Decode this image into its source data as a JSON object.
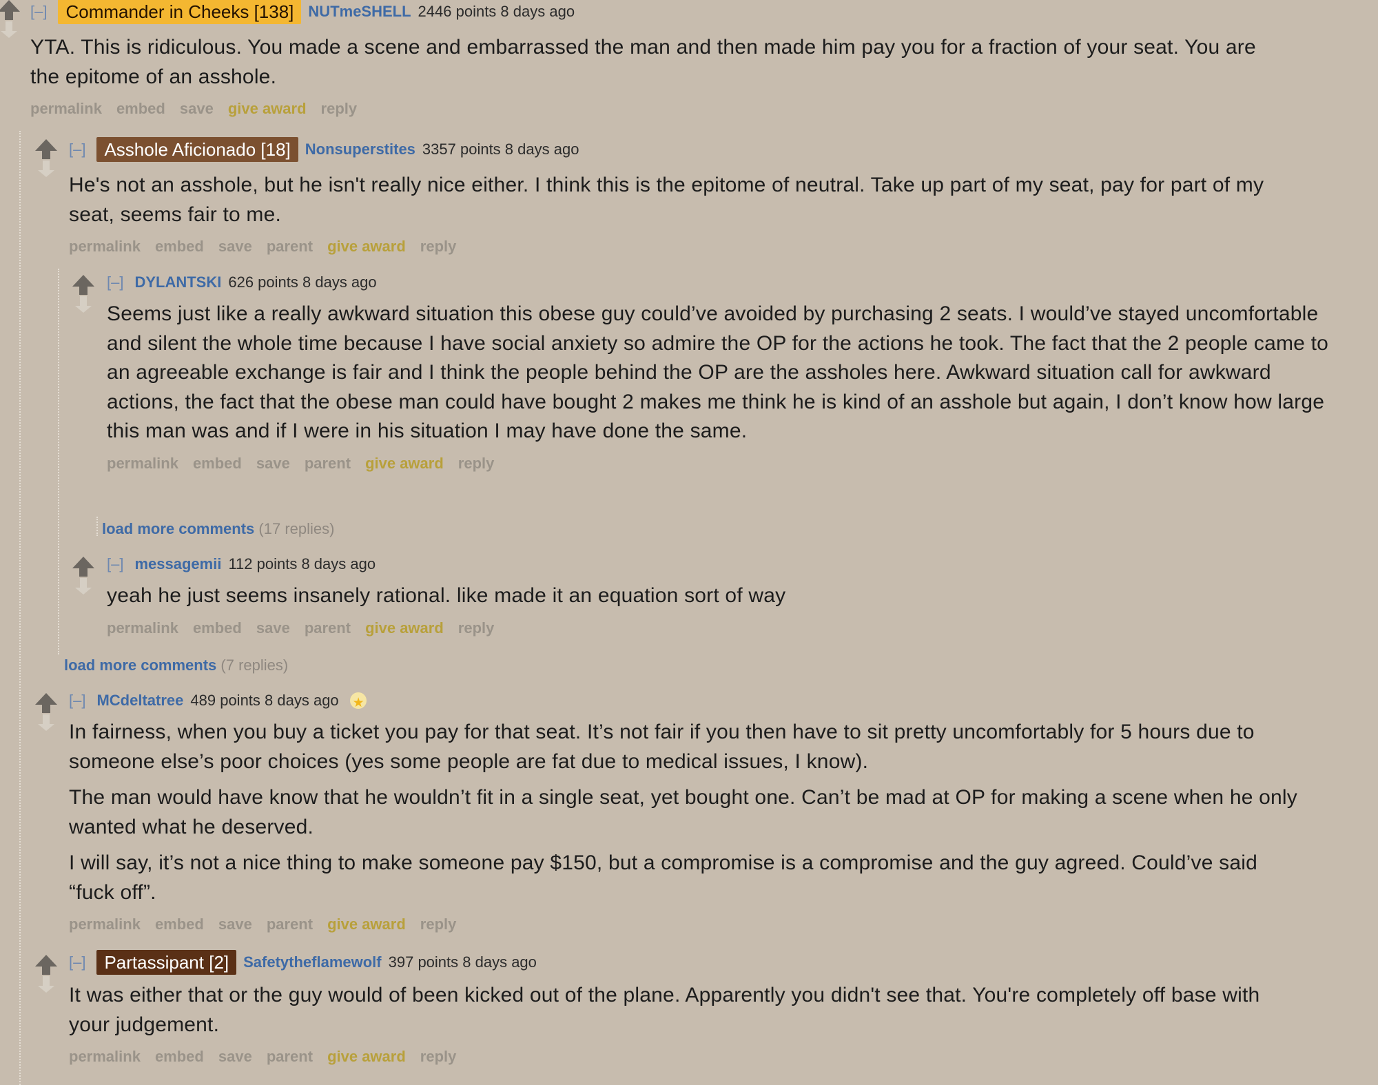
{
  "toggle_label": "[–]",
  "buttons": {
    "permalink": "permalink",
    "embed": "embed",
    "save": "save",
    "parent": "parent",
    "give_award": "give award",
    "reply": "reply"
  },
  "comments": {
    "c1": {
      "flair": "Commander in Cheeks [138]",
      "author": "NUTmeSHELL",
      "score_time": "2446 points 8 days ago",
      "body": [
        "YTA. This is ridiculous. You made a scene and embarrassed the man and then made him pay you for a fraction of your seat. You are the epitome of an asshole."
      ]
    },
    "c2": {
      "flair": "Asshole Aficionado [18]",
      "author": "Nonsuperstites",
      "score_time": "3357 points 8 days ago",
      "body": [
        "He's not an asshole, but he isn't really nice either. I think this is the epitome of neutral. Take up part of my seat, pay for part of my seat, seems fair to me."
      ]
    },
    "c3": {
      "author": "DYLANTSKI",
      "score_time": "626 points 8 days ago",
      "body": [
        "Seems just like a really awkward situation this obese guy could’ve avoided by purchasing 2 seats. I would’ve stayed uncomfortable and silent the whole time because I have social anxiety so admire the OP for the actions he took. The fact that the 2 people came to an agreeable exchange is fair and I think the people behind the OP are the assholes here. Awkward situation call for awkward actions, the fact that the obese man could have bought 2 makes me think he is kind of an asshole but again, I don’t know how large this man was and if I were in his situation I may have done the same."
      ]
    },
    "c3_load_more": {
      "label": "load more comments",
      "count": "(17 replies)"
    },
    "c4": {
      "author": "messagemii",
      "score_time": "112 points 8 days ago",
      "body": [
        "yeah he just seems insanely rational. like made it an equation sort of way"
      ]
    },
    "c2_load_more": {
      "label": "load more comments",
      "count": "(7 replies)"
    },
    "c5": {
      "author": "MCdeltatree",
      "score_time": "489 points 8 days ago",
      "body": [
        "In fairness, when you buy a ticket you pay for that seat. It’s not fair if you then have to sit pretty uncomfortably for 5 hours due to someone else’s poor choices (yes some people are fat due to medical issues, I know).",
        "The man would have know that he wouldn’t fit in a single seat, yet bought one. Can’t be mad at OP for making a scene when he only wanted what he deserved.",
        "I will say, it’s not a nice thing to make someone pay $150, but a compromise is a compromise and the guy agreed. Could’ve said “fuck off”."
      ]
    },
    "c6": {
      "flair": "Partassipant [2]",
      "author": "Safetytheflamewolf",
      "score_time": "397 points 8 days ago",
      "body": [
        "It was either that or the guy would of been kicked out of the plane. Apparently you didn't see that. You're completely off base with your judgement."
      ]
    }
  }
}
